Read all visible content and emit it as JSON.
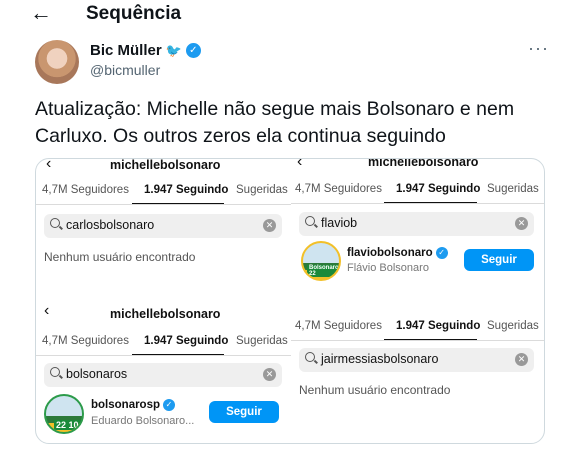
{
  "header": {
    "back_icon": "arrow-left-icon",
    "title": "Sequência"
  },
  "author": {
    "name": "Bic Müller",
    "handle": "@bicmuller",
    "more": "···"
  },
  "tweet": {
    "text": "Atualização: Michelle não segue mais Bolsonaro e nem Carluxo. Os outros zeros ela continua seguindo"
  },
  "screens": [
    {
      "username": "michellebolsonaro",
      "tabs": [
        "4,7M Seguidores",
        "1.947 Seguindo",
        "Sugeridas"
      ],
      "search": "carlosbolsonaro",
      "result_text": "Nenhum usuário encontrado"
    },
    {
      "username": "michellebolsonaro",
      "tabs": [
        "4,7M Seguidores",
        "1.947 Seguindo",
        "Sugeridas"
      ],
      "search": "flaviob",
      "result": {
        "name": "flaviobolsonaro",
        "sub": "Flávio Bolsonaro",
        "badge": "Bolsonaro 22",
        "button": "Seguir"
      }
    },
    {
      "username": "michellebolsonaro",
      "tabs": [
        "4,7M Seguidores",
        "1.947 Seguindo",
        "Sugeridas"
      ],
      "search": "bolsonaros",
      "result": {
        "name": "bolsonarosp",
        "sub": "Eduardo Bolsonaro...",
        "badge": "22 10",
        "button": "Seguir"
      }
    },
    {
      "tabs": [
        "4,7M Seguidores",
        "1.947 Seguindo",
        "Sugeridas"
      ],
      "search": "jairmessiasbolsonaro",
      "result_text": "Nenhum usuário encontrado"
    }
  ]
}
